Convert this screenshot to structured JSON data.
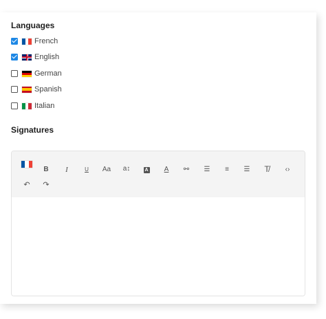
{
  "languages": {
    "title": "Languages",
    "items": [
      {
        "label": "French",
        "checked": true,
        "flag": "fr"
      },
      {
        "label": "English",
        "checked": true,
        "flag": "uk"
      },
      {
        "label": "German",
        "checked": false,
        "flag": "de"
      },
      {
        "label": "Spanish",
        "checked": false,
        "flag": "es"
      },
      {
        "label": "Italian",
        "checked": false,
        "flag": "it"
      }
    ]
  },
  "signatures": {
    "title": "Signatures",
    "active_flag": "fr",
    "toolbar": {
      "bold": "B",
      "italic": "I",
      "underline": "U",
      "font_size": "Aa",
      "line_height": "a↕",
      "highlight": "A",
      "text_color": "A",
      "link": "⚯",
      "bullet_list": "☰",
      "ordered_list": "≡",
      "align": "☰",
      "clear_format": "T̸",
      "code": "‹›",
      "undo": "↶",
      "redo": "↷"
    }
  },
  "colors": {
    "checkbox_checked": "#1e88e5",
    "toolbar_bg": "#f4f4f4"
  }
}
